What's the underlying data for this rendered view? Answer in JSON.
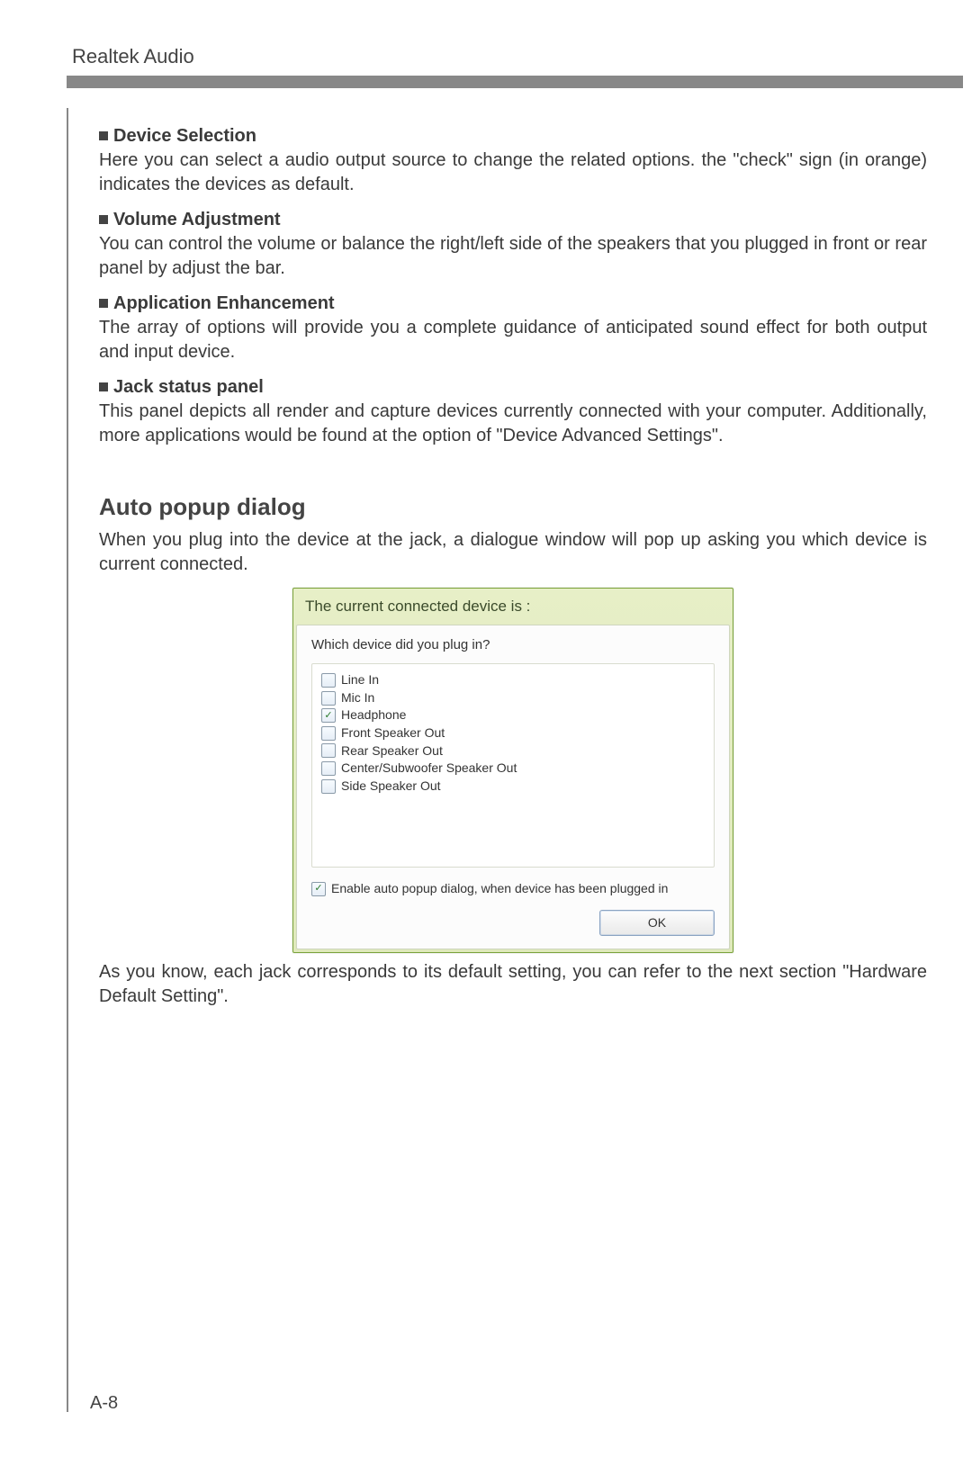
{
  "header": {
    "title": "Realtek Audio"
  },
  "sections": [
    {
      "title": "Device Selection",
      "body": "Here you can select a audio output source to change the related options. the \"check\" sign (in orange) indicates the devices as default."
    },
    {
      "title": "Volume Adjustment",
      "body": "You can control the volume or balance the right/left side of the speakers that you plugged in front or rear panel by adjust the bar."
    },
    {
      "title": "Application Enhancement",
      "body": "The array of options will provide you a complete guidance of anticipated sound effect for both output and input device."
    },
    {
      "title": "Jack status panel",
      "body": "This panel depicts all render and capture devices currently connected with your computer. Additionally, more applications would be found at the option of \"Device Advanced Settings\"."
    }
  ],
  "auto_popup": {
    "heading": "Auto popup dialog",
    "intro": "When you plug into the device at the jack, a dialogue window will pop up asking you which device is current connected.",
    "post": "As you know, each jack corresponds to its default setting, you can refer to the next section \"Hardware Default Setting\"."
  },
  "dialog": {
    "title": "The current connected device is :",
    "prompt": "Which device did you plug in?",
    "devices": [
      {
        "label": "Line In",
        "checked": false
      },
      {
        "label": "Mic In",
        "checked": false
      },
      {
        "label": "Headphone",
        "checked": true
      },
      {
        "label": "Front Speaker Out",
        "checked": false
      },
      {
        "label": "Rear Speaker Out",
        "checked": false
      },
      {
        "label": "Center/Subwoofer Speaker Out",
        "checked": false
      },
      {
        "label": "Side Speaker Out",
        "checked": false
      }
    ],
    "enable_auto": {
      "label": "Enable auto popup dialog, when device has been plugged in",
      "checked": true
    },
    "ok_label": "OK"
  },
  "page_number": "A-8"
}
